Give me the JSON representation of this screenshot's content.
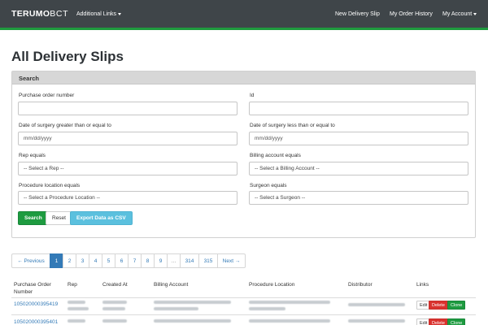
{
  "navbar": {
    "brand_main": "TERUMO",
    "brand_sub": "BCT",
    "additional_links": "Additional Links",
    "new_delivery_slip": "New Delivery Slip",
    "my_order_history": "My Order History",
    "my_account": "My Account"
  },
  "page": {
    "title": "All Delivery Slips"
  },
  "search": {
    "heading": "Search",
    "purchase_order_label": "Purchase order number",
    "purchase_order_value": "",
    "id_label": "Id",
    "id_value": "",
    "surgery_gte_label": "Date of surgery greater than or equal to",
    "surgery_gte_placeholder": "mm/dd/yyyy",
    "surgery_lte_label": "Date of surgery less than or equal to",
    "surgery_lte_placeholder": "mm/dd/yyyy",
    "rep_label": "Rep equals",
    "rep_selected": "-- Select a Rep --",
    "billing_label": "Billing account equals",
    "billing_selected": "-- Select a Billing Account --",
    "procedure_label": "Procedure location equals",
    "procedure_selected": "-- Select a Procedure Location --",
    "surgeon_label": "Surgeon equals",
    "surgeon_selected": "-- Select a Surgeon --",
    "search_button": "Search",
    "reset_button": "Reset",
    "export_button": "Export Data as CSV"
  },
  "pagination": {
    "previous": "← Previous",
    "pages": [
      "1",
      "2",
      "3",
      "4",
      "5",
      "6",
      "7",
      "8",
      "9",
      "…",
      "314",
      "315"
    ],
    "next": "Next →",
    "active_page": "1"
  },
  "table": {
    "headers": {
      "purchase_order": "Purchase Order Number",
      "rep": "Rep",
      "created_at": "Created At",
      "billing_account": "Billing Account",
      "procedure_location": "Procedure Location",
      "distributor": "Distributor",
      "links": "Links"
    },
    "rows": [
      {
        "purchase_order": "105020000395419",
        "edit": "Edit",
        "delete": "Delete",
        "clone": "Clone"
      },
      {
        "purchase_order": "105020000395401",
        "edit": "Edit",
        "delete": "Delete",
        "clone": "Clone"
      }
    ]
  },
  "colors": {
    "navbar_bg": "#3f4549",
    "accent_green": "#1f9a3e",
    "link_blue": "#337ab7",
    "export_blue": "#5bc0de",
    "delete_red": "#d9322e"
  }
}
